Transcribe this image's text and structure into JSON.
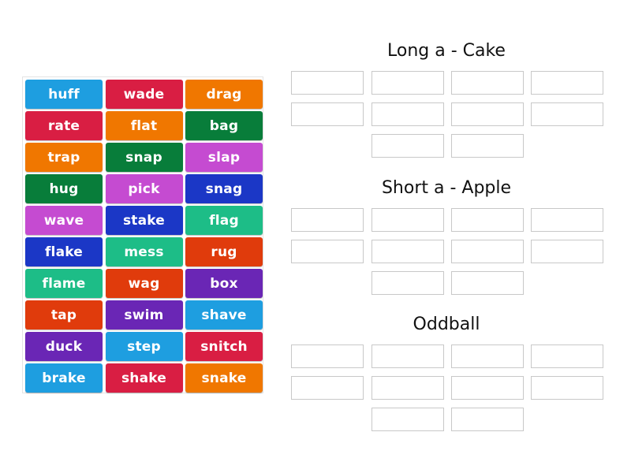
{
  "activity": "group-sort",
  "tile_pool": {
    "tiles": [
      {
        "label": "huff",
        "color": "#1e9ee0"
      },
      {
        "label": "wade",
        "color": "#d91e43"
      },
      {
        "label": "drag",
        "color": "#f07700"
      },
      {
        "label": "rate",
        "color": "#d91e43"
      },
      {
        "label": "flat",
        "color": "#f07700"
      },
      {
        "label": "bag",
        "color": "#087d3a"
      },
      {
        "label": "trap",
        "color": "#f07700"
      },
      {
        "label": "snap",
        "color": "#087d3a"
      },
      {
        "label": "slap",
        "color": "#c54bd1"
      },
      {
        "label": "hug",
        "color": "#087d3a"
      },
      {
        "label": "pick",
        "color": "#c54bd1"
      },
      {
        "label": "snag",
        "color": "#1b37c6"
      },
      {
        "label": "wave",
        "color": "#c54bd1"
      },
      {
        "label": "stake",
        "color": "#1b37c6"
      },
      {
        "label": "flag",
        "color": "#1dbd87"
      },
      {
        "label": "flake",
        "color": "#1b37c6"
      },
      {
        "label": "mess",
        "color": "#1dbd87"
      },
      {
        "label": "rug",
        "color": "#e03b0c"
      },
      {
        "label": "flame",
        "color": "#1dbd87"
      },
      {
        "label": "wag",
        "color": "#e03b0c"
      },
      {
        "label": "box",
        "color": "#6a26b5"
      },
      {
        "label": "tap",
        "color": "#e03b0c"
      },
      {
        "label": "swim",
        "color": "#6a26b5"
      },
      {
        "label": "shave",
        "color": "#1e9ee0"
      },
      {
        "label": "duck",
        "color": "#6a26b5"
      },
      {
        "label": "step",
        "color": "#1e9ee0"
      },
      {
        "label": "snitch",
        "color": "#d91e43"
      },
      {
        "label": "brake",
        "color": "#1e9ee0"
      },
      {
        "label": "shake",
        "color": "#d91e43"
      },
      {
        "label": "snake",
        "color": "#f07700"
      }
    ]
  },
  "groups": [
    {
      "title": "Long a - Cake",
      "empty_slots": 10
    },
    {
      "title": "Short a - Apple",
      "empty_slots": 10
    },
    {
      "title": "Oddball",
      "empty_slots": 10
    }
  ]
}
